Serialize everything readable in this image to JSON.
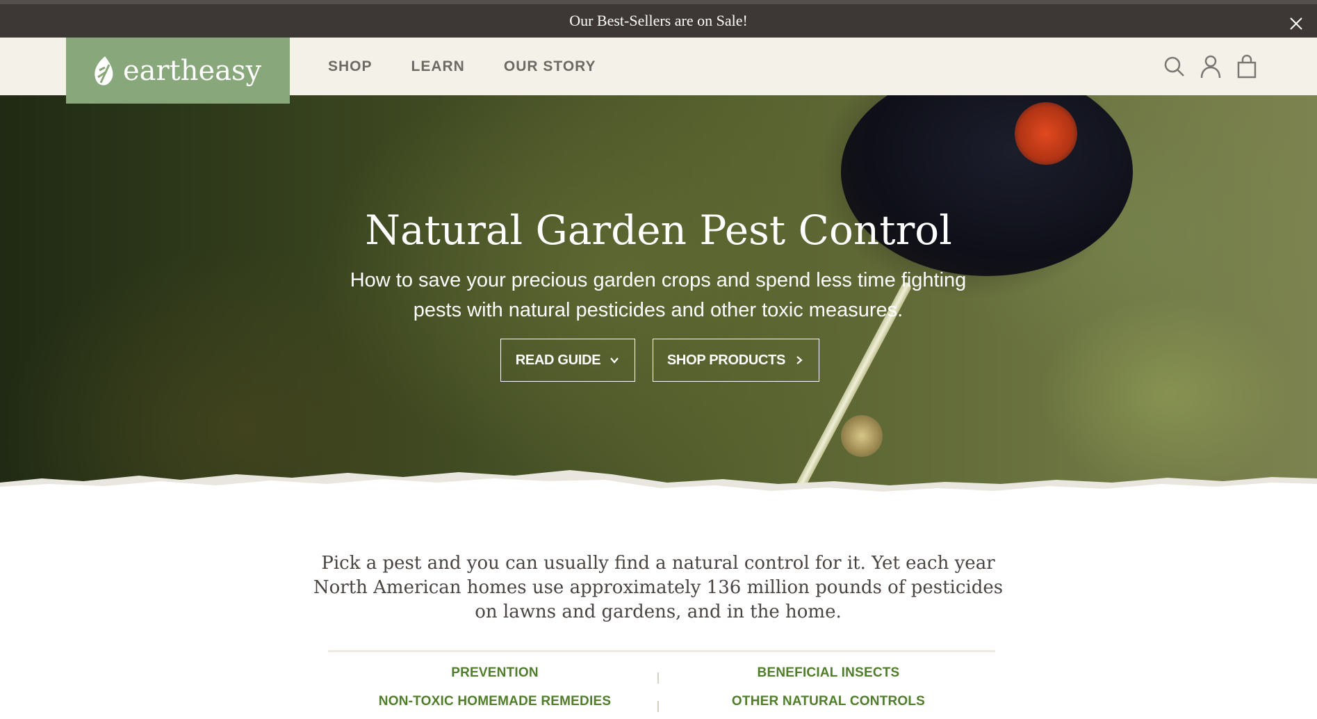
{
  "announcement": {
    "text": "Our Best-Sellers are on Sale!",
    "close_icon": "close-icon"
  },
  "header": {
    "logo_text": "eartheasy",
    "nav": [
      {
        "label": "SHOP"
      },
      {
        "label": "LEARN"
      },
      {
        "label": "OUR STORY"
      }
    ],
    "icons": [
      "search-icon",
      "account-icon",
      "cart-icon"
    ]
  },
  "hero": {
    "title": "Natural Garden Pest Control",
    "subtitle": "How to save your precious garden crops and spend less time fighting pests with natural pesticides and other toxic measures.",
    "buttons": {
      "read_guide": "READ GUIDE",
      "shop_products": "SHOP PRODUCTS"
    }
  },
  "intro": {
    "text": "Pick a pest and you can usually find a natural control for it. Yet each year North American homes use approximately 136 million pounds of pesticides on lawns and gardens, and in the home."
  },
  "toc": {
    "left": [
      "PREVENTION",
      "NON-TOXIC HOMEMADE REMEDIES"
    ],
    "right": [
      "BENEFICIAL INSECTS",
      "OTHER NATURAL CONTROLS"
    ]
  },
  "colors": {
    "announcement_bg": "#3d3735",
    "header_bg": "#f4f1e8",
    "logo_bg": "#88a77a",
    "nav_text": "#6d6a66",
    "toc_link": "#4f7d2a"
  }
}
